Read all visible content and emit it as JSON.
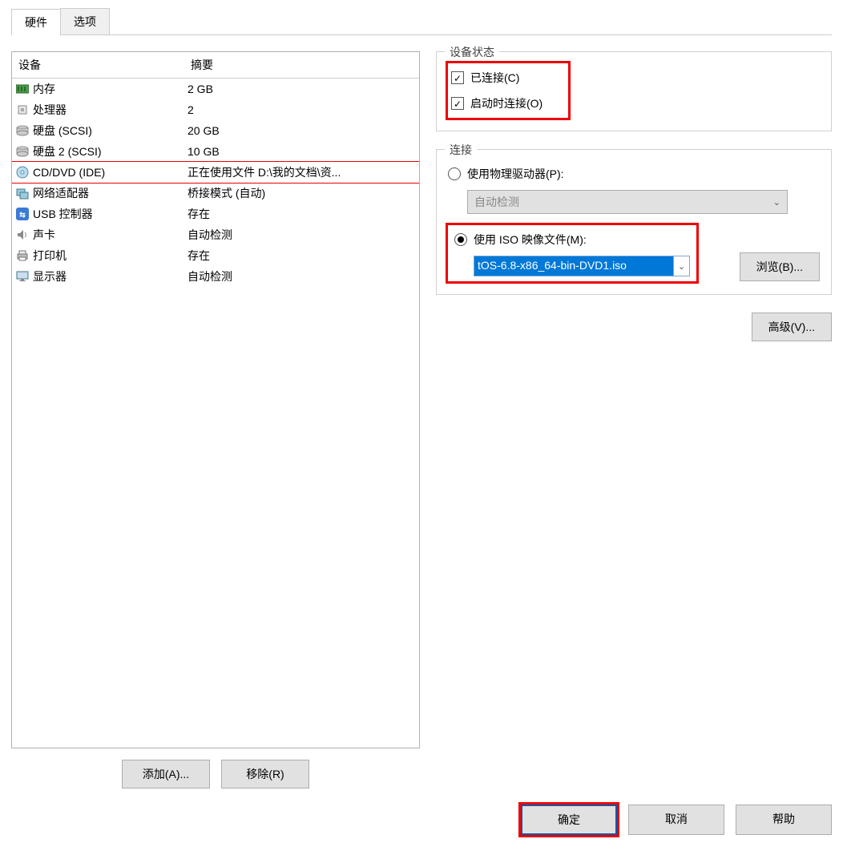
{
  "tabs": {
    "hardware": "硬件",
    "options": "选项"
  },
  "headers": {
    "device": "设备",
    "summary": "摘要"
  },
  "devices": [
    {
      "icon": "memory-icon",
      "name": "内存",
      "summary": "2 GB"
    },
    {
      "icon": "cpu-icon",
      "name": "处理器",
      "summary": "2"
    },
    {
      "icon": "disk-icon",
      "name": "硬盘 (SCSI)",
      "summary": "20 GB"
    },
    {
      "icon": "disk-icon",
      "name": "硬盘 2 (SCSI)",
      "summary": "10 GB"
    },
    {
      "icon": "cd-icon",
      "name": "CD/DVD (IDE)",
      "summary": "正在使用文件 D:\\我的文档\\资...",
      "selected": true
    },
    {
      "icon": "network-icon",
      "name": "网络适配器",
      "summary": "桥接模式 (自动)"
    },
    {
      "icon": "usb-icon",
      "name": "USB 控制器",
      "summary": "存在"
    },
    {
      "icon": "sound-icon",
      "name": "声卡",
      "summary": "自动检测"
    },
    {
      "icon": "printer-icon",
      "name": "打印机",
      "summary": "存在"
    },
    {
      "icon": "display-icon",
      "name": "显示器",
      "summary": "自动检测"
    }
  ],
  "leftButtons": {
    "add": "添加(A)...",
    "remove": "移除(R)"
  },
  "deviceStatus": {
    "legend": "设备状态",
    "connected": "已连接(C)",
    "connectAtPowerOn": "启动时连接(O)"
  },
  "connection": {
    "legend": "连接",
    "physical": "使用物理驱动器(P):",
    "physicalValue": "自动检测",
    "iso": "使用 ISO 映像文件(M):",
    "isoValue": "tOS-6.8-x86_64-bin-DVD1.iso",
    "browse": "浏览(B)..."
  },
  "advanced": "高级(V)...",
  "bottom": {
    "ok": "确定",
    "cancel": "取消",
    "help": "帮助"
  }
}
